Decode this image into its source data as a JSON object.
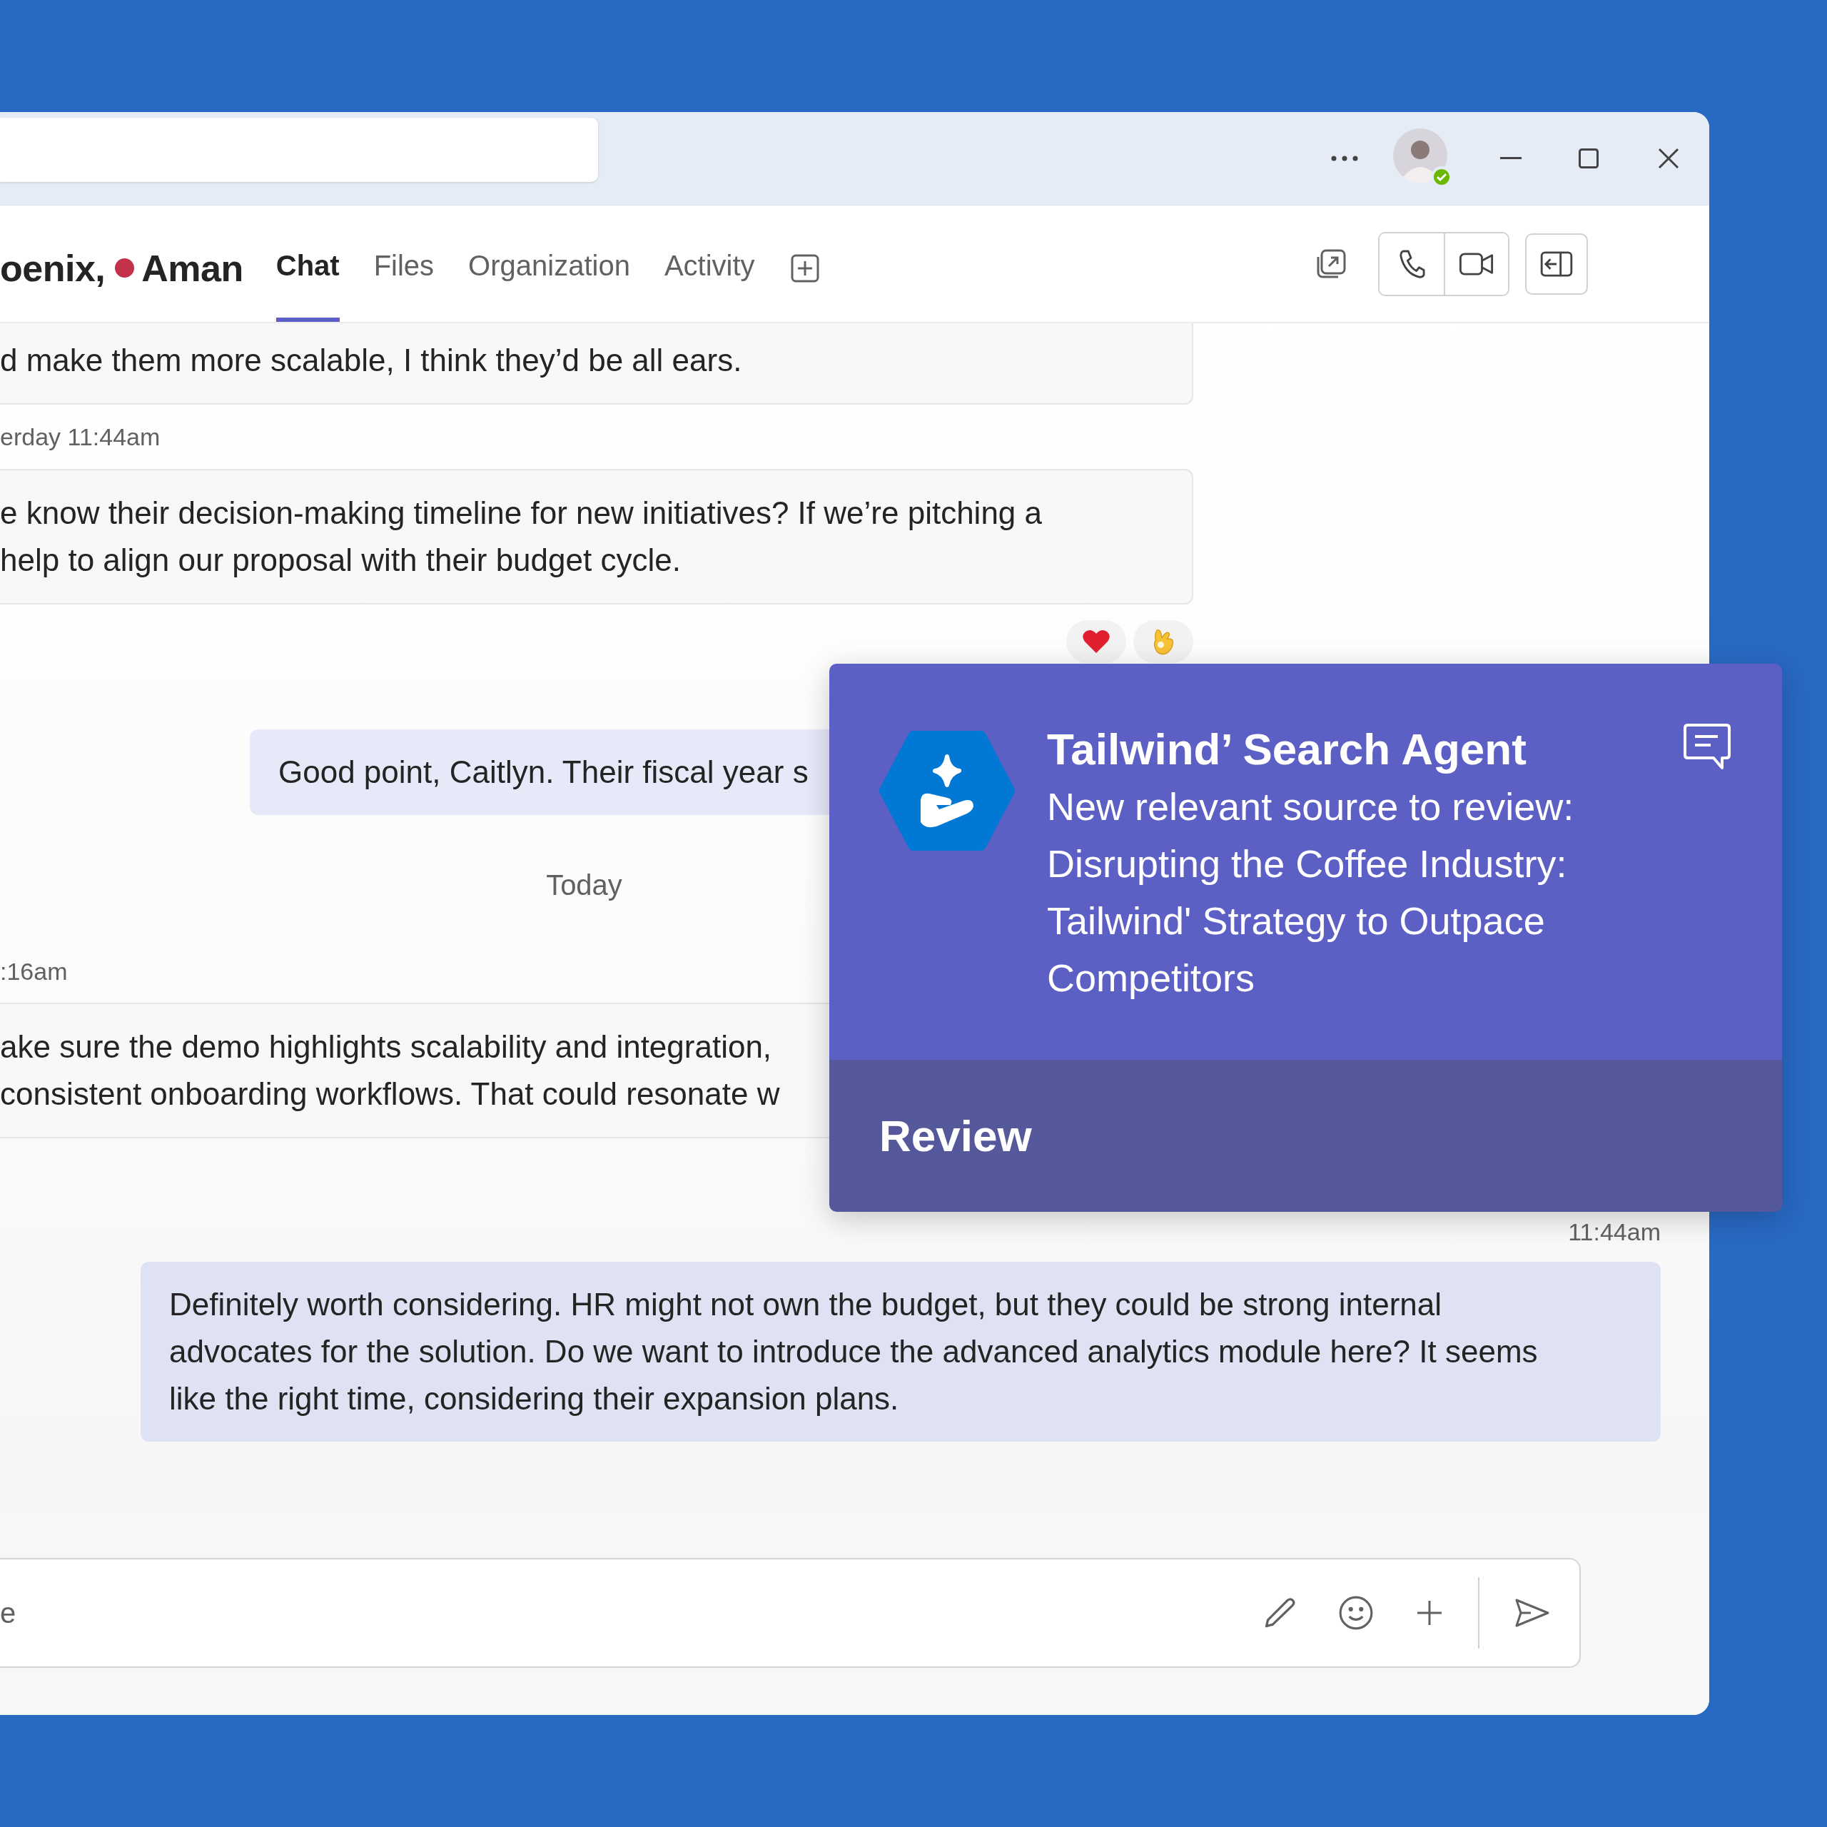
{
  "chat_header": {
    "participants": [
      {
        "name": "oenix,"
      },
      {
        "name": "Aman",
        "color": "#c4314b"
      }
    ],
    "tabs": [
      {
        "label": "Chat",
        "selected": true
      },
      {
        "label": "Files",
        "selected": false
      },
      {
        "label": "Organization",
        "selected": false
      },
      {
        "label": "Activity",
        "selected": false
      }
    ]
  },
  "messages": [
    {
      "kind": "received",
      "lines": [
        "d make them more scalable, I think they’d be all ears."
      ]
    },
    {
      "kind": "meta",
      "text": "erday 11:44am"
    },
    {
      "kind": "received",
      "lines": [
        "e know their decision-making timeline for new initiatives? If we’re pitching a",
        "help to align our proposal with their budget cycle."
      ]
    },
    {
      "kind": "reactions",
      "items": [
        {
          "kind": "heart"
        },
        {
          "kind": "ok"
        }
      ]
    },
    {
      "kind": "sent",
      "lines": [
        "Good point, Caitlyn. Their fiscal year s"
      ]
    },
    {
      "kind": "divider",
      "text": "Today"
    },
    {
      "kind": "meta",
      "text": ":16am"
    },
    {
      "kind": "received",
      "lines": [
        "ake sure the demo highlights scalability and integration,",
        "consistent onboarding workflows. That could resonate w"
      ]
    },
    {
      "kind": "meta_sent",
      "text": "11:44am"
    },
    {
      "kind": "sent",
      "lines": [
        "Definitely worth considering. HR might not own the budget, but they could be strong internal",
        "advocates for the solution. Do we want to introduce the advanced analytics module here? It seems",
        "like the right time, considering their expansion plans."
      ]
    }
  ],
  "compose": {
    "placeholder": "e"
  },
  "notification": {
    "title": "Tailwind’ Search Agent",
    "body": "New relevant source to review: Disrupting the Coffee Industry: Tailwind' Strategy to Outpace Competitors",
    "action": "Review"
  }
}
